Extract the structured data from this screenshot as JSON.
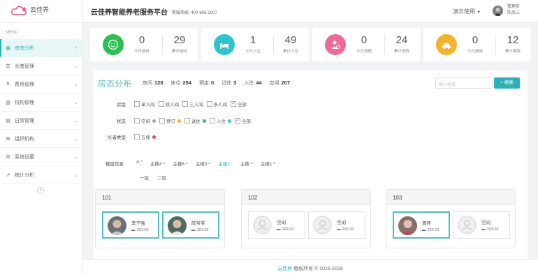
{
  "brand": {
    "name_cn": "云佳养",
    "name_en": "Cloud care"
  },
  "sidebar": {
    "menu_label": "MENU",
    "items": [
      {
        "label": "房态分布",
        "active": true
      },
      {
        "label": "长者管理"
      },
      {
        "label": "费用管理"
      },
      {
        "label": "机构管理"
      },
      {
        "label": "日常管理"
      },
      {
        "label": "组织机构"
      },
      {
        "label": "系统设置"
      },
      {
        "label": "统计分析"
      }
    ]
  },
  "header": {
    "title": "云佳养智能养老服务平台",
    "hotline": "客服热线: 400-606-2007",
    "demo": "演示使用",
    "user_role": "管理员",
    "user_name": "陈凤三"
  },
  "stats": [
    {
      "color": "#2ebf52",
      "items": [
        {
          "num": "0",
          "caption": "今日接待"
        },
        {
          "num": "29",
          "caption": "累计接待"
        }
      ]
    },
    {
      "color": "#2ec4cf",
      "items": [
        {
          "num": "1",
          "caption": "今日入住"
        },
        {
          "num": "49",
          "caption": "累计入住"
        }
      ]
    },
    {
      "color": "#f06895",
      "items": [
        {
          "num": "0",
          "caption": "今日请假"
        },
        {
          "num": "24",
          "caption": "累计请假"
        }
      ]
    },
    {
      "color": "#f3b32a",
      "items": [
        {
          "num": "0",
          "caption": "今日离院"
        },
        {
          "num": "12",
          "caption": "累计离院"
        }
      ]
    }
  ],
  "panel": {
    "title": "房态分布",
    "summary": [
      {
        "k": "房间",
        "v": "128"
      },
      {
        "k": "床位",
        "v": "254"
      },
      {
        "k": "预定",
        "v": "0"
      },
      {
        "k": "试住",
        "v": "3"
      },
      {
        "k": "入住",
        "v": "44"
      },
      {
        "k": "空闲",
        "v": "207"
      }
    ],
    "search_placeholder": "输入姓名",
    "search_button": "搜索",
    "filters": {
      "room_type": {
        "label": "房型",
        "options": [
          {
            "t": "单人间"
          },
          {
            "t": "双人间"
          },
          {
            "t": "三人间"
          },
          {
            "t": "多人间"
          },
          {
            "t": "全部",
            "checked": true
          }
        ]
      },
      "status": {
        "label": "状态",
        "options": [
          {
            "t": "空闲",
            "dot": "#9aa7b5"
          },
          {
            "t": "预订",
            "dot": "#f3b32a"
          },
          {
            "t": "试住",
            "dot": "#2ebf52"
          },
          {
            "t": "入住",
            "dot": "#2ec4cf"
          },
          {
            "t": "全部",
            "checked": true
          }
        ]
      },
      "elder_type": {
        "label": "长者类型",
        "options": [
          {
            "t": "五保",
            "dot": "#e8467c"
          }
        ]
      }
    },
    "floors": {
      "label": "楼层信息",
      "buildings": [
        {
          "t": "A"
        },
        {
          "t": "主楼4"
        },
        {
          "t": "主楼6"
        },
        {
          "t": "主楼3"
        },
        {
          "t": "主楼2",
          "active": true
        },
        {
          "t": "主楼"
        },
        {
          "t": "主楼1"
        }
      ],
      "levels": [
        "一层",
        "二层"
      ]
    }
  },
  "rooms": [
    {
      "no": "101",
      "beds": [
        {
          "name": "李子强",
          "id": "101-01",
          "occupied": true
        },
        {
          "name": "陈爷爷",
          "id": "101-02",
          "occupied": true
        }
      ]
    },
    {
      "no": "102",
      "beds": [
        {
          "name": "空闲",
          "id": "102-01",
          "occupied": false
        },
        {
          "name": "空闲",
          "id": "102-02",
          "occupied": false
        }
      ]
    },
    {
      "no": "103",
      "beds": [
        {
          "name": "周怀",
          "id": "103-01",
          "occupied": true
        },
        {
          "name": "空闲",
          "id": "103-02",
          "occupied": false
        }
      ]
    }
  ],
  "footer": {
    "brand": "云佳养",
    "text": " 版权所有 © 2016-2018"
  }
}
